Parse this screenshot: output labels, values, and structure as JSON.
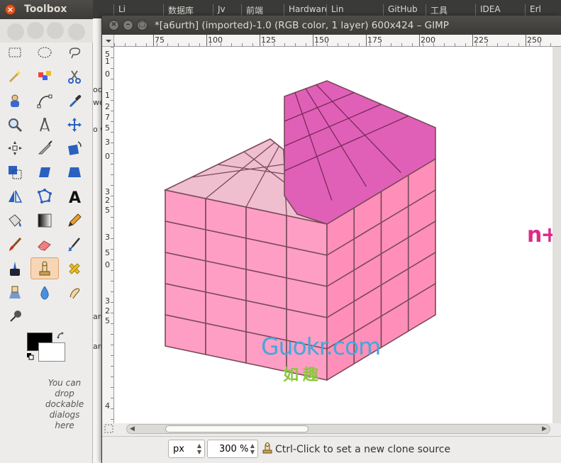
{
  "background_tabs": [
    "Li",
    "数据库",
    "Jv",
    "前端",
    "Hardware",
    "Lin",
    "GitHub",
    "工具",
    "IDEA",
    "Erl"
  ],
  "behind_window_fragments": [
    "oc",
    "we",
    "o w",
    "aro",
    "aro"
  ],
  "toolbox": {
    "title": "Toolbox",
    "close_symbol": "×",
    "tools": [
      {
        "name": "rect-select",
        "icon": "rect-select-icon"
      },
      {
        "name": "ellipse-select",
        "icon": "ellipse-select-icon"
      },
      {
        "name": "free-select",
        "icon": "lasso-icon"
      },
      {
        "name": "fuzzy-select",
        "icon": "magic-wand-icon"
      },
      {
        "name": "select-by-color",
        "icon": "color-select-icon"
      },
      {
        "name": "scissors-select",
        "icon": "scissors-icon"
      },
      {
        "name": "foreground-select",
        "icon": "foreground-select-icon"
      },
      {
        "name": "paths",
        "icon": "paths-icon"
      },
      {
        "name": "color-picker",
        "icon": "eyedropper-icon"
      },
      {
        "name": "zoom",
        "icon": "magnifier-icon"
      },
      {
        "name": "measure",
        "icon": "compass-icon"
      },
      {
        "name": "move",
        "icon": "move-arrows-icon"
      },
      {
        "name": "align",
        "icon": "align-icon"
      },
      {
        "name": "crop",
        "icon": "knife-icon"
      },
      {
        "name": "rotate",
        "icon": "rotate-icon"
      },
      {
        "name": "scale",
        "icon": "scale-icon"
      },
      {
        "name": "shear",
        "icon": "shear-icon"
      },
      {
        "name": "perspective",
        "icon": "perspective-icon"
      },
      {
        "name": "flip",
        "icon": "flip-icon"
      },
      {
        "name": "cage-transform",
        "icon": "cage-icon"
      },
      {
        "name": "text",
        "icon": "text-a-icon"
      },
      {
        "name": "bucket-fill",
        "icon": "bucket-icon"
      },
      {
        "name": "blend",
        "icon": "gradient-icon"
      },
      {
        "name": "pencil",
        "icon": "pencil-icon"
      },
      {
        "name": "paintbrush",
        "icon": "paintbrush-icon"
      },
      {
        "name": "eraser",
        "icon": "eraser-icon"
      },
      {
        "name": "airbrush",
        "icon": "airbrush-icon"
      },
      {
        "name": "ink",
        "icon": "ink-icon"
      },
      {
        "name": "clone",
        "icon": "clone-stamp-icon"
      },
      {
        "name": "heal",
        "icon": "heal-icon"
      },
      {
        "name": "perspective-clone",
        "icon": "perspective-clone-icon"
      },
      {
        "name": "blur-sharpen",
        "icon": "water-drop-icon"
      },
      {
        "name": "smudge",
        "icon": "smudge-icon"
      },
      {
        "name": "dodge-burn",
        "icon": "dodge-burn-icon"
      }
    ],
    "active_tool": "clone",
    "foreground_color": "#000000",
    "background_color": "#ffffff",
    "dock_hint": "You can drop dockable dialogs here"
  },
  "image_window": {
    "title": "*[a6urth] (imported)-1.0 (RGB color, 1 layer) 600x424 – GIMP",
    "ruler_top_labels": [
      "75",
      "100",
      "125",
      "150",
      "175",
      "200",
      "225",
      "250"
    ],
    "ruler_left_labels": [
      "5",
      "1",
      "0",
      "1",
      "2",
      "7",
      "5",
      "3",
      "0",
      "3",
      "2",
      "5",
      "3",
      "5",
      "0",
      "3",
      "2",
      "5",
      "4"
    ],
    "watermark_main": "Guokr.com",
    "watermark_sub": "如趣",
    "edge_text": "n+",
    "statusbar": {
      "unit": "px",
      "zoom": "300 %",
      "message": "Ctrl-Click to set a new clone source"
    }
  },
  "colors": {
    "titlebar": "#3c3b37",
    "cube_front": "#ff9ec4",
    "cube_top_light": "#efbfcf",
    "cube_top_magenta": "#e060b8",
    "watermark_blue": "#46a6dc",
    "watermark_green": "#8cc63e"
  }
}
